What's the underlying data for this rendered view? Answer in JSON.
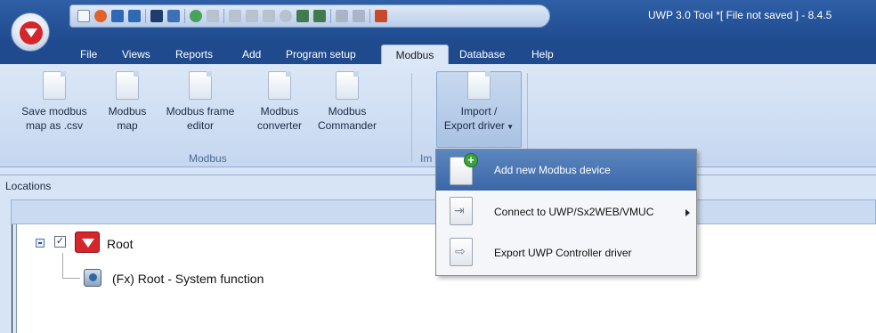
{
  "window": {
    "title": "UWP 3.0 Tool *[ File not saved ] - 8.4.5"
  },
  "menu": {
    "tabs": [
      "File",
      "Views",
      "Reports",
      "Add",
      "Program setup",
      "Modbus",
      "Database",
      "Help"
    ],
    "active": "Modbus"
  },
  "ribbon": {
    "buttons": {
      "save_map": [
        "Save modbus",
        "map as .csv"
      ],
      "map": [
        "Modbus",
        "map"
      ],
      "frame_editor": [
        "Modbus frame",
        "editor"
      ],
      "converter": [
        "Modbus",
        "converter"
      ],
      "commander": [
        "Modbus",
        "Commander"
      ],
      "import_export": [
        "Import /",
        "Export driver"
      ]
    },
    "groups": {
      "modbus": "Modbus",
      "import": "Im"
    }
  },
  "panel": {
    "title": "Locations"
  },
  "tree": {
    "root": "Root",
    "child": "(Fx) Root - System function",
    "root_checked": true
  },
  "dropdown": {
    "items": [
      "Add new Modbus device",
      "Connect to UWP/Sx2WEB/VMUC",
      "Export UWP Controller driver"
    ],
    "highlighted_index": 0
  },
  "colors": {
    "titlebar": "#1f4a8e",
    "ribbon": "#dbe7f7",
    "highlight": "#4a76b3",
    "brand_red": "#d5262c"
  }
}
